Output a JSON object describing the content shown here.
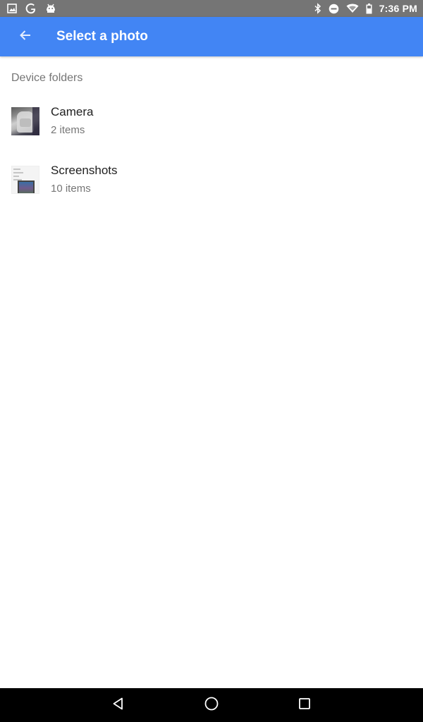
{
  "status_bar": {
    "time": "7:36 PM",
    "left_icons": [
      "image-icon",
      "google-icon",
      "android-icon"
    ],
    "right_icons": [
      "bluetooth-icon",
      "do-not-disturb-icon",
      "wifi-icon",
      "battery-icon"
    ]
  },
  "app_bar": {
    "title": "Select a photo",
    "background": "#4285f4"
  },
  "section": {
    "header": "Device folders"
  },
  "folders": [
    {
      "name": "Camera",
      "count": "2 items",
      "thumbnail": "camera-thumbnail"
    },
    {
      "name": "Screenshots",
      "count": "10 items",
      "thumbnail": "screenshots-thumbnail"
    }
  ],
  "nav_bar": {
    "buttons": [
      "back-icon",
      "home-icon",
      "recents-icon"
    ]
  }
}
